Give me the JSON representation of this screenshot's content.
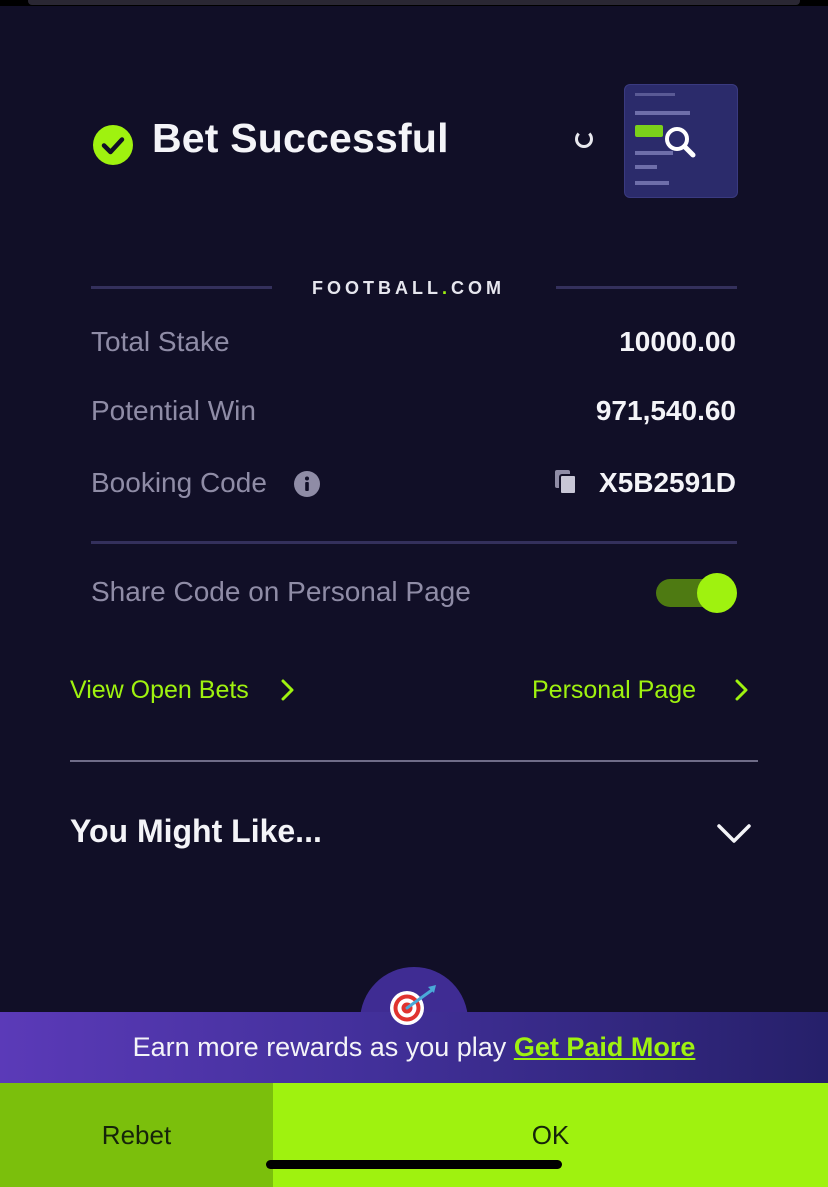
{
  "header": {
    "title": "Bet Successful"
  },
  "brand": {
    "name_part1": "FOOTBALL",
    "name_dot": ".",
    "name_part2": "COM"
  },
  "summary": {
    "total_stake_label": "Total Stake",
    "total_stake_value": "10000.00",
    "potential_win_label": "Potential Win",
    "potential_win_value": "971,540.60",
    "booking_code_label": "Booking Code",
    "booking_code_value": "X5B2591D"
  },
  "share": {
    "label": "Share Code on Personal Page",
    "enabled": true
  },
  "links": {
    "open_bets": "View Open Bets",
    "personal_page": "Personal Page"
  },
  "recommend": {
    "title": "You Might Like..."
  },
  "rewards": {
    "text": "Earn more rewards as you play ",
    "cta": "Get Paid More"
  },
  "actions": {
    "rebet": "Rebet",
    "ok": "OK"
  },
  "colors": {
    "background": "#110f27",
    "accent": "#9ff20f",
    "muted_text": "#8f8ca6",
    "rebet_bg": "#7bbf0c",
    "banner_purple": "#5b3ab8"
  },
  "icons": [
    "check-circle-icon",
    "loading-spinner-icon",
    "magnifier-icon",
    "info-icon",
    "copy-icon",
    "chevron-right-icon",
    "chevron-down-icon",
    "target-dart-icon"
  ]
}
